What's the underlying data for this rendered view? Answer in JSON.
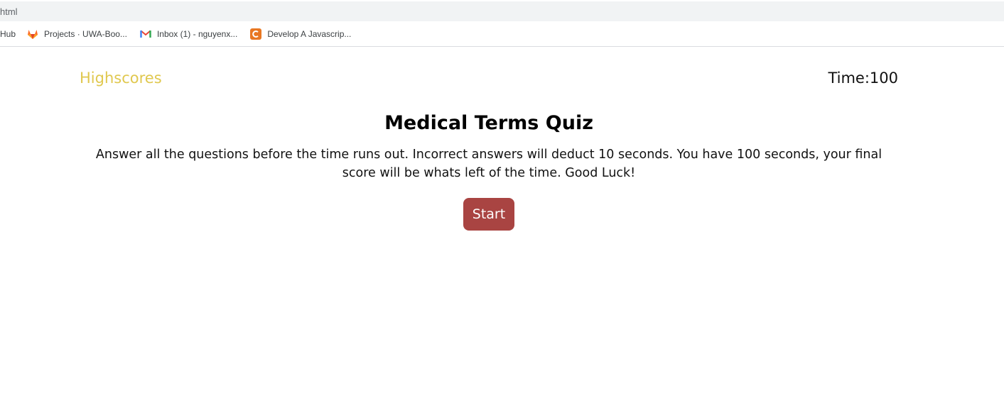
{
  "browser": {
    "url_fragment": "html",
    "bookmarks": [
      {
        "label": "Hub",
        "icon": "github-icon"
      },
      {
        "label": "Projects · UWA-Boo...",
        "icon": "gitlab-icon"
      },
      {
        "label": "Inbox (1) - nguyenx...",
        "icon": "gmail-icon"
      },
      {
        "label": "Develop A Javascrip...",
        "icon": "canvas-icon"
      }
    ]
  },
  "header": {
    "highscores_label": "Highscores",
    "timer_label": "Time:",
    "timer_value": "100"
  },
  "main": {
    "title": "Medical Terms Quiz",
    "description": "Answer all the questions before the time runs out. Incorrect answers will deduct 10 seconds. You have 100 seconds, your final score will be whats left of the time. Good Luck!",
    "start_label": "Start"
  },
  "colors": {
    "highscores": "#e0c84f",
    "start_button": "#a94442"
  }
}
